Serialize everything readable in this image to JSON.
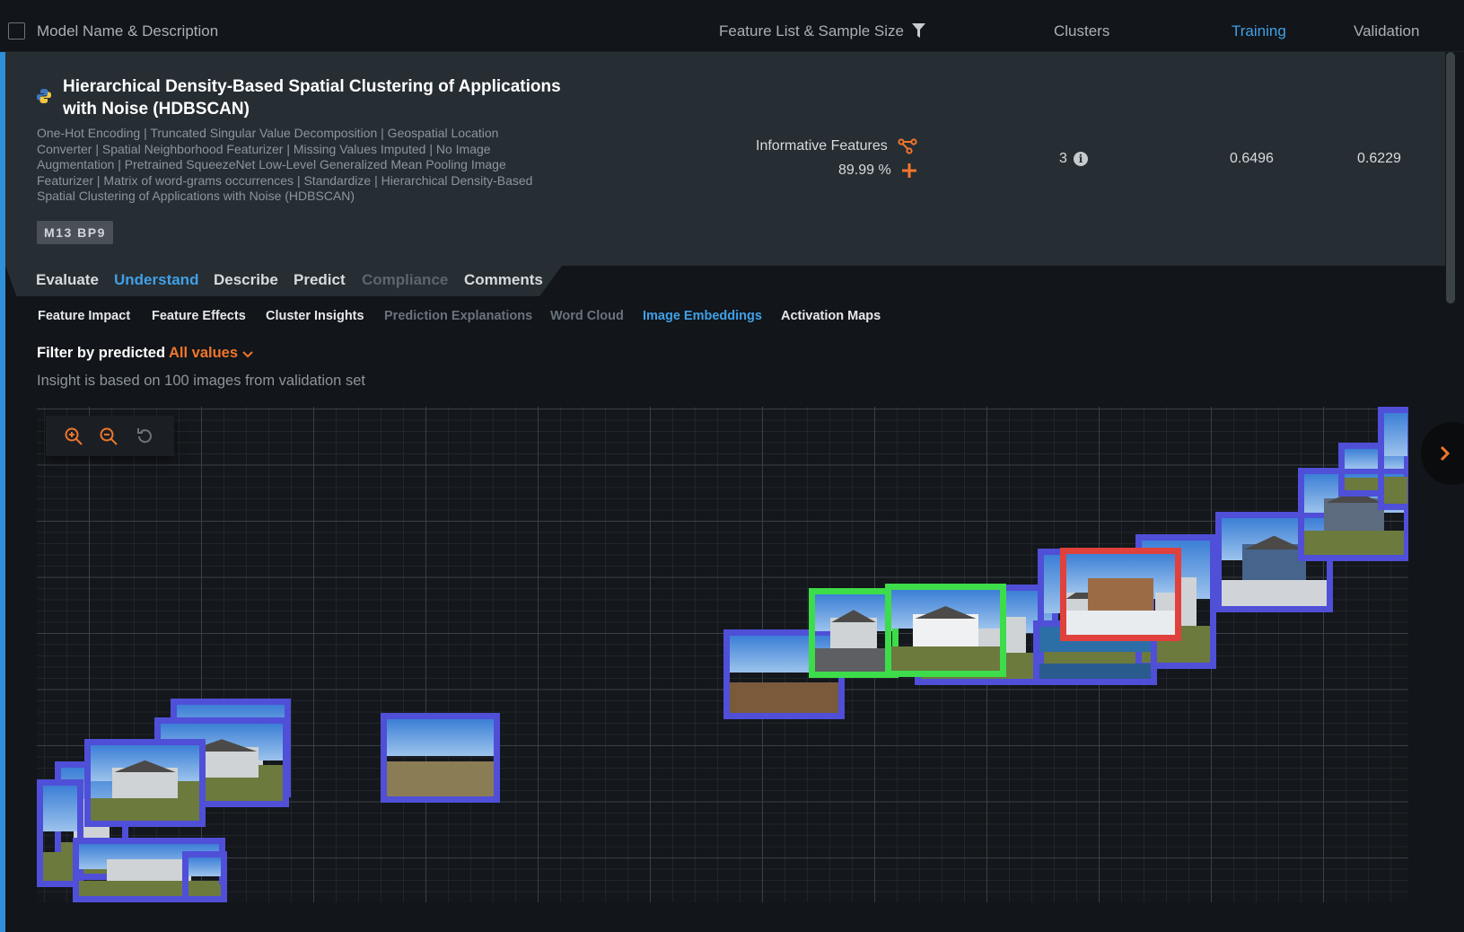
{
  "header": {
    "model_col": "Model Name & Description",
    "feature_col": "Feature List & Sample Size",
    "clusters_col": "Clusters",
    "training_col": "Training",
    "validation_col": "Validation"
  },
  "model": {
    "title": "Hierarchical Density-Based Spatial Clustering of Applications with Noise (HDBSCAN)",
    "description": "One-Hot Encoding | Truncated Singular Value Decomposition | Geospatial Location Converter | Spatial Neighborhood Featurizer | Missing Values Imputed | No Image Augmentation | Pretrained SqueezeNet Low-Level Generalized Mean Pooling Image Featurizer | Matrix of word-grams occurrences | Standardize | Hierarchical Density-Based Spatial Clustering of Applications with Noise (HDBSCAN)",
    "badge": "M13  BP9",
    "feature_list": "Informative Features",
    "sample_size": "89.99 %",
    "clusters": "3",
    "training": "0.6496",
    "validation": "0.6229"
  },
  "tabs": [
    "Evaluate",
    "Understand",
    "Describe",
    "Predict",
    "Compliance",
    "Comments"
  ],
  "active_tab": "Understand",
  "subtabs": [
    "Feature Impact",
    "Feature Effects",
    "Cluster Insights",
    "Prediction Explanations",
    "Word Cloud",
    "Image Embeddings",
    "Activation Maps"
  ],
  "active_subtab": "Image Embeddings",
  "filter": {
    "label": "Filter by predicted",
    "value": "All values"
  },
  "insight_text": "Insight is based on 100 images from validation set",
  "colors": {
    "accent": "#41a0e6",
    "orange": "#f0762c",
    "cluster_blue": "#4f4fd8",
    "highlight_green": "#3ddc4a",
    "highlight_red": "#e0413c"
  },
  "icons": [
    "python-icon",
    "filter-icon",
    "feature-graph-icon",
    "add-icon",
    "info-icon",
    "zoom-in-icon",
    "zoom-out-icon",
    "reset-icon",
    "chevron-right-icon",
    "chevron-down-icon"
  ]
}
